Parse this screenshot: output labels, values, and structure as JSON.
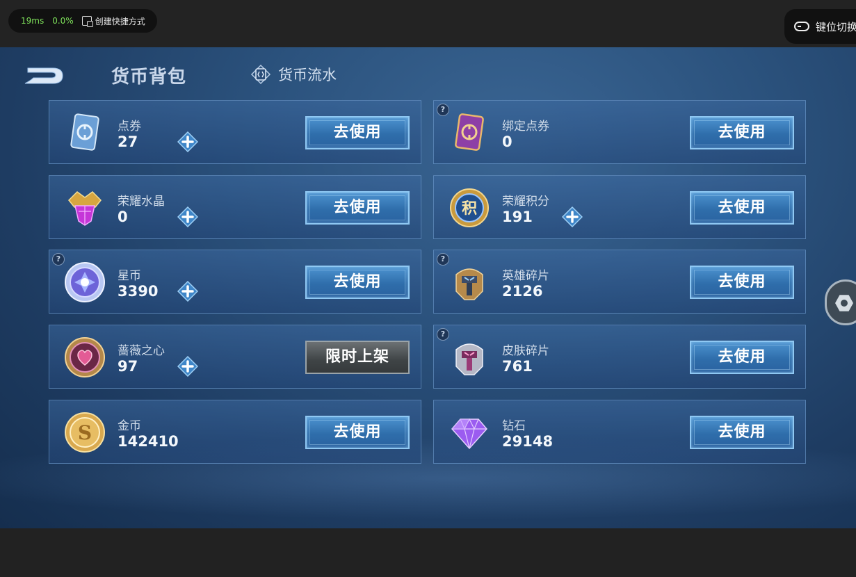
{
  "emulator": {
    "latency": "19ms",
    "cpu": "0.0%",
    "shortcut_label": "创建快捷方式",
    "key_switch_label": "键位切换"
  },
  "header": {
    "title": "货币背包",
    "flow_tab": "货币流水"
  },
  "colors": {
    "use_button": "#3a7dbe",
    "limited_button": "#4a4f52",
    "background": "#2b527d"
  },
  "currencies": [
    {
      "name": "点券",
      "value": "27",
      "has_plus": true,
      "has_help": false,
      "button": "去使用",
      "icon": "ticket-card-icon"
    },
    {
      "name": "绑定点券",
      "value": "0",
      "has_plus": false,
      "has_help": true,
      "button": "去使用",
      "icon": "bound-ticket-card-icon"
    },
    {
      "name": "荣耀水晶",
      "value": "0",
      "has_plus": true,
      "has_help": false,
      "button": "去使用",
      "icon": "glory-crystal-icon"
    },
    {
      "name": "荣耀积分",
      "value": "191",
      "has_plus": true,
      "has_help": false,
      "button": "去使用",
      "icon": "glory-points-icon"
    },
    {
      "name": "星币",
      "value": "3390",
      "has_plus": true,
      "has_help": true,
      "button": "去使用",
      "icon": "star-coin-icon"
    },
    {
      "name": "英雄碎片",
      "value": "2126",
      "has_plus": false,
      "has_help": true,
      "button": "去使用",
      "icon": "hero-shard-icon"
    },
    {
      "name": "蔷薇之心",
      "value": "97",
      "has_plus": true,
      "has_help": false,
      "button": "限时上架",
      "icon": "rose-heart-icon"
    },
    {
      "name": "皮肤碎片",
      "value": "761",
      "has_plus": false,
      "has_help": true,
      "button": "去使用",
      "icon": "skin-shard-icon"
    },
    {
      "name": "金币",
      "value": "142410",
      "has_plus": false,
      "has_help": false,
      "button": "去使用",
      "icon": "gold-coin-icon"
    },
    {
      "name": "钻石",
      "value": "29148",
      "has_plus": false,
      "has_help": false,
      "button": "去使用",
      "icon": "diamond-icon"
    }
  ]
}
